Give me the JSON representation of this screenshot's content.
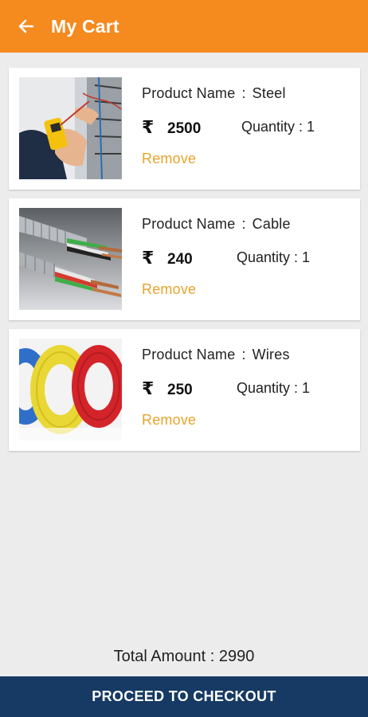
{
  "appbar": {
    "title": "My Cart",
    "back_icon": "arrow-left-icon",
    "color": "#f58a1f"
  },
  "cart": {
    "items": [
      {
        "name_label": "Product Name",
        "separator": ":",
        "name": "Steel",
        "currency": "₹",
        "price": "2500",
        "quantity_label": "Quantity : 1",
        "remove_label": "Remove",
        "image": "electrician-multimeter-image"
      },
      {
        "name_label": "Product Name",
        "separator": ":",
        "name": "Cable",
        "currency": "₹",
        "price": "240",
        "quantity_label": "Quantity : 1",
        "remove_label": "Remove",
        "image": "armored-cable-image"
      },
      {
        "name_label": "Product Name",
        "separator": ":",
        "name": "Wires",
        "currency": "₹",
        "price": "250",
        "quantity_label": "Quantity : 1",
        "remove_label": "Remove",
        "image": "wire-coils-image"
      }
    ]
  },
  "footer": {
    "total_label": "Total Amount : 2990",
    "checkout_label": "PROCEED TO CHECKOUT",
    "checkout_color": "#163a63"
  },
  "colors": {
    "accent": "#f58a1f",
    "remove": "#e8a32c",
    "background": "#ececec"
  }
}
